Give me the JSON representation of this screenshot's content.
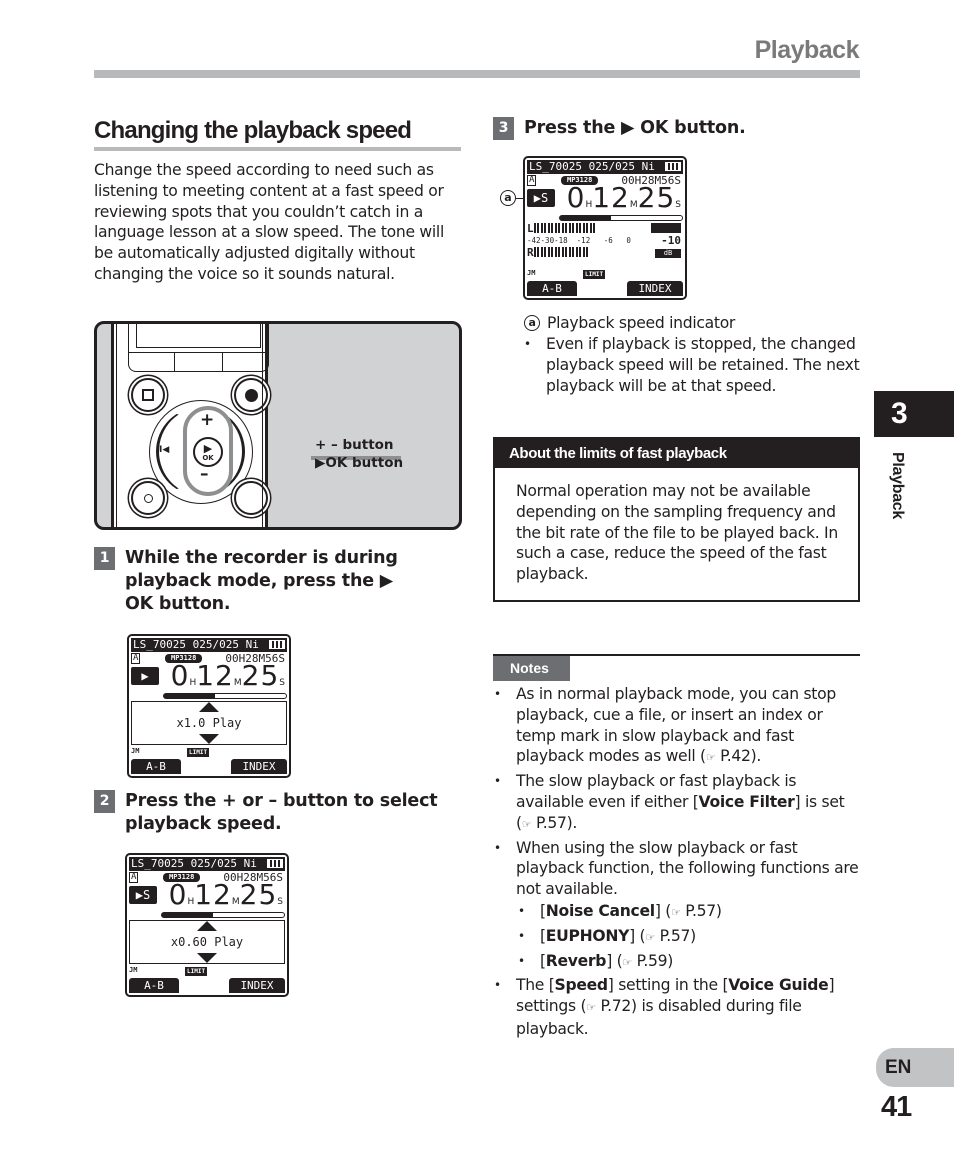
{
  "header": {
    "title": "Playback"
  },
  "section": {
    "title": "Changing the playback speed",
    "intro": "Change the speed according to need such as listening to meeting content at a fast speed or reviewing spots that you couldn’t catch in a language lesson at a slow speed. The tone will be automatically adjusted digitally without changing the voice so it sounds natural."
  },
  "illustration": {
    "labels": [
      "+ – button",
      "▶OK button"
    ],
    "plus": "+",
    "minus": "–",
    "ok_glyph": "▶",
    "ok_label": "OK",
    "rewind_glyph": "I◀"
  },
  "steps": [
    {
      "number": "1",
      "text": "While the recorder is during playback mode, press the ▶ OK button."
    },
    {
      "number": "2",
      "text": "Press the + or – button to select playback speed."
    },
    {
      "number": "3",
      "text": "Press the ▶ OK button."
    }
  ],
  "lcd": {
    "filename": "LS_70025",
    "file_count": "025/025",
    "battery_type": "Ni",
    "folder": "A",
    "format": "MP3128",
    "length": "00H28M56S",
    "elapsed": {
      "h": "0",
      "m": "12",
      "s": "25"
    },
    "progress": 0.42,
    "softkey_left": "A-B",
    "softkey_right": "INDEX",
    "mic_indicator": "JM",
    "limit_indicator": "LIMIT",
    "screens": [
      {
        "play_icon": "▶",
        "speed": "x1.0 Play"
      },
      {
        "play_icon": "▶S",
        "speed": "x0.60 Play"
      },
      {
        "play_icon": "▶S",
        "meter_scale": "-42-30-18  -12   -6   0",
        "meter_value": "-10",
        "meter_unit": "dB",
        "left_channel": "L",
        "right_channel": "R"
      }
    ]
  },
  "callout": {
    "marker": "a",
    "label": "Playback speed indicator",
    "bullet": "Even if playback is stopped, the changed playback speed will be retained. The next playback will be at that speed."
  },
  "limits_box": {
    "title": "About the limits of fast playback",
    "body": "Normal operation may not be available depending on the sampling frequency and the bit rate of the file to be played back. In such a case, reduce the speed of the fast playback."
  },
  "notes": {
    "tag": "Notes",
    "ref_icon": "☞",
    "items": [
      {
        "text": "As in normal playback mode, you can stop playback, cue a file, or insert an index or temp mark in slow playback and fast playback modes as well (",
        "ref": "P.42",
        "tail": ")."
      },
      {
        "pre": "The slow playback or fast playback is available even if either [",
        "bold": "Voice Filter",
        "post": "] is set (",
        "ref": "P.57",
        "tail": ")."
      },
      {
        "text": "When using the slow playback or fast playback function, the following functions are not available."
      },
      {
        "bold": "Noise Cancel",
        "ref": "P.57"
      },
      {
        "bold": "EUPHONY",
        "ref": "P.57"
      },
      {
        "bold": "Reverb",
        "ref": "P.59"
      },
      {
        "pre": "The [",
        "bold": "Speed",
        "mid": "] setting in the [",
        "bold2": "Voice Guide",
        "post": "] settings (",
        "ref": "P.72",
        "tail": ") is disabled during file playback."
      }
    ]
  },
  "sidebar": {
    "chapter_number": "3",
    "chapter_label": "Playback",
    "language": "EN",
    "page_number": "41"
  }
}
